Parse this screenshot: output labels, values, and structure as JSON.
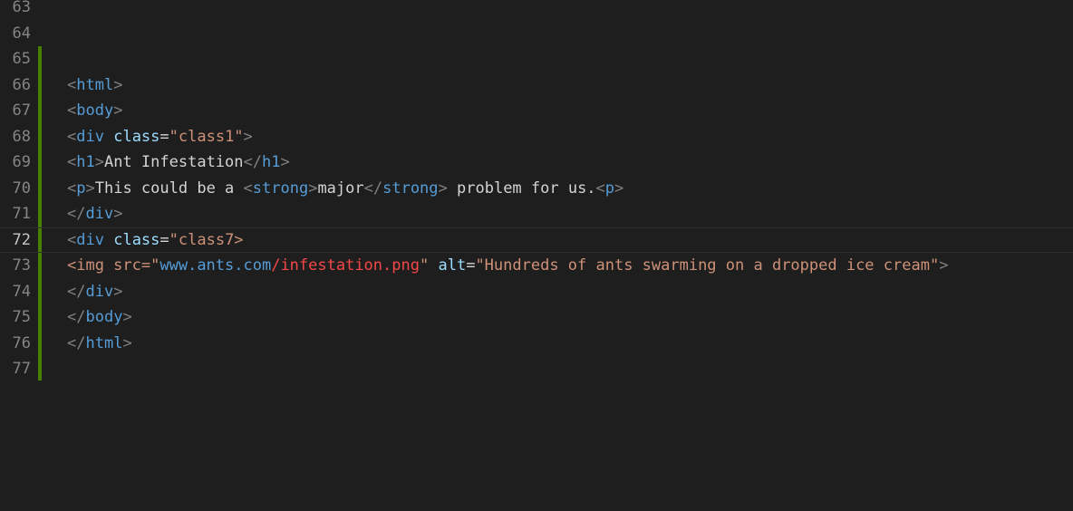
{
  "editor": {
    "colors": {
      "background": "#1e1e1e",
      "line_number": "#858585",
      "active_line_number": "#c6c6c6",
      "tag": "#569cd6",
      "attribute": "#9cdcfe",
      "string": "#ce9178",
      "bracket": "#808080",
      "text": "#d4d4d4",
      "error": "#f44747",
      "added_marker": "#487e02"
    },
    "active_line": "72",
    "lines": [
      {
        "number": "63",
        "tokens": []
      },
      {
        "number": "64",
        "tokens": []
      },
      {
        "number": "65",
        "tokens": []
      },
      {
        "number": "66",
        "tokens": [
          {
            "t": "punct",
            "v": "<"
          },
          {
            "t": "tag",
            "v": "html"
          },
          {
            "t": "punct",
            "v": ">"
          }
        ]
      },
      {
        "number": "67",
        "tokens": [
          {
            "t": "punct",
            "v": "<"
          },
          {
            "t": "tag",
            "v": "body"
          },
          {
            "t": "punct",
            "v": ">"
          }
        ]
      },
      {
        "number": "68",
        "tokens": [
          {
            "t": "punct",
            "v": "<"
          },
          {
            "t": "tag",
            "v": "div"
          },
          {
            "t": "text",
            "v": " "
          },
          {
            "t": "attr",
            "v": "class"
          },
          {
            "t": "eq",
            "v": "="
          },
          {
            "t": "str",
            "v": "\"class1\""
          },
          {
            "t": "punct",
            "v": ">"
          }
        ]
      },
      {
        "number": "69",
        "tokens": [
          {
            "t": "punct",
            "v": "<"
          },
          {
            "t": "tag",
            "v": "h1"
          },
          {
            "t": "punct",
            "v": ">"
          },
          {
            "t": "text",
            "v": "Ant Infestation"
          },
          {
            "t": "punct",
            "v": "</"
          },
          {
            "t": "tag",
            "v": "h1"
          },
          {
            "t": "punct",
            "v": ">"
          }
        ]
      },
      {
        "number": "70",
        "tokens": [
          {
            "t": "punct",
            "v": "<"
          },
          {
            "t": "tag",
            "v": "p"
          },
          {
            "t": "punct",
            "v": ">"
          },
          {
            "t": "text",
            "v": "This could be a "
          },
          {
            "t": "punct",
            "v": "<"
          },
          {
            "t": "tag",
            "v": "strong"
          },
          {
            "t": "punct",
            "v": ">"
          },
          {
            "t": "text",
            "v": "major"
          },
          {
            "t": "punct",
            "v": "</"
          },
          {
            "t": "tag",
            "v": "strong"
          },
          {
            "t": "punct",
            "v": ">"
          },
          {
            "t": "text",
            "v": " problem for us."
          },
          {
            "t": "punct",
            "v": "<"
          },
          {
            "t": "tag",
            "v": "p"
          },
          {
            "t": "punct",
            "v": ">"
          }
        ]
      },
      {
        "number": "71",
        "tokens": [
          {
            "t": "punct",
            "v": "</"
          },
          {
            "t": "tag",
            "v": "div"
          },
          {
            "t": "punct",
            "v": ">"
          }
        ]
      },
      {
        "number": "72",
        "tokens": [
          {
            "t": "punct",
            "v": "<"
          },
          {
            "t": "tag",
            "v": "div"
          },
          {
            "t": "text",
            "v": " "
          },
          {
            "t": "attr",
            "v": "class"
          },
          {
            "t": "eq",
            "v": "="
          },
          {
            "t": "str",
            "v": "\"class7>"
          }
        ]
      },
      {
        "number": "73",
        "tokens": [
          {
            "t": "str",
            "v": "<img src="
          },
          {
            "t": "str",
            "v": "\""
          },
          {
            "t": "tag",
            "v": "www.ants.com"
          },
          {
            "t": "err",
            "v": "/infestation.png"
          },
          {
            "t": "str",
            "v": "\""
          },
          {
            "t": "text",
            "v": " "
          },
          {
            "t": "attr",
            "v": "alt"
          },
          {
            "t": "eq",
            "v": "="
          },
          {
            "t": "str",
            "v": "\"Hundreds of ants swarming on a dropped ice cream\""
          },
          {
            "t": "punct",
            "v": ">"
          }
        ]
      },
      {
        "number": "74",
        "tokens": [
          {
            "t": "punct",
            "v": "</"
          },
          {
            "t": "tag",
            "v": "div"
          },
          {
            "t": "punct",
            "v": ">"
          }
        ]
      },
      {
        "number": "75",
        "tokens": [
          {
            "t": "punct",
            "v": "</"
          },
          {
            "t": "tag",
            "v": "body"
          },
          {
            "t": "punct",
            "v": ">"
          }
        ]
      },
      {
        "number": "76",
        "tokens": [
          {
            "t": "punct",
            "v": "</"
          },
          {
            "t": "tag",
            "v": "html"
          },
          {
            "t": "punct",
            "v": ">"
          }
        ]
      },
      {
        "number": "77",
        "tokens": []
      }
    ]
  }
}
